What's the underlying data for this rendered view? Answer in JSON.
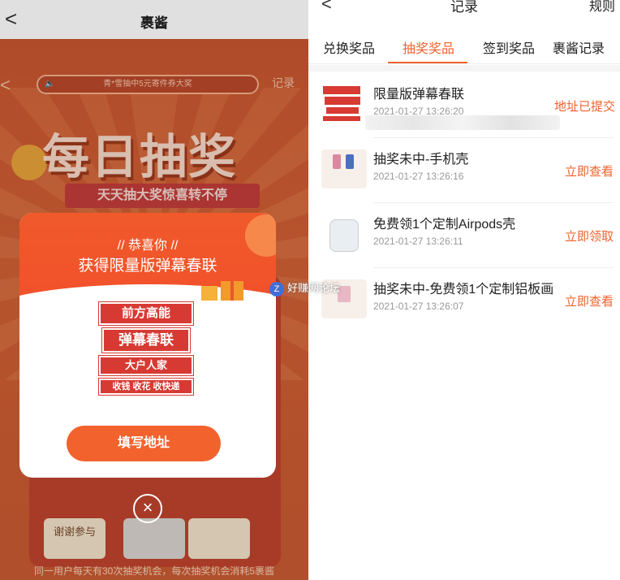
{
  "left": {
    "back": "<",
    "title": "裹酱",
    "bg_back": "<",
    "ticker": "青*雪抽中5元寄件券大奖",
    "record": "记录",
    "big_title": "每日抽奖",
    "subtitle": "天天抽大奖惊喜转不停",
    "cell_thanks": "谢谢参与",
    "footer": "同一用户每天有30次抽奖机会，每次抽奖机会消耗5裹酱",
    "modal": {
      "congrats": "恭喜你",
      "prize": "获得限量版弹幕春联",
      "couplet": [
        "前方高能",
        "弹幕春联",
        "大户人家",
        "收钱 收花 收快递"
      ],
      "button": "填写地址"
    },
    "close": "×"
  },
  "right": {
    "back": "<",
    "title": "记录",
    "rules": "规则",
    "tabs": [
      "兑换奖品",
      "抽奖奖品",
      "签到奖品",
      "裹酱记录"
    ],
    "active_tab": 1,
    "records": [
      {
        "name": "限量版弹幕春联",
        "time": "2021-01-27 13:26:20",
        "status": "地址已提交"
      },
      {
        "name": "抽奖未中-手机壳",
        "time": "2021-01-27 13:26:16",
        "status": "立即查看"
      },
      {
        "name": "免费领1个定制Airpods壳",
        "time": "2021-01-27 13:26:11",
        "status": "立即领取"
      },
      {
        "name": "抽奖未中-免费领1个定制铝板画",
        "time": "2021-01-27 13:26:07",
        "status": "立即查看"
      }
    ]
  },
  "watermark": "好赚网论坛",
  "watermark_logo": "Z",
  "colors": {
    "accent": "#f0622d",
    "bg_orange": "#d06035"
  }
}
